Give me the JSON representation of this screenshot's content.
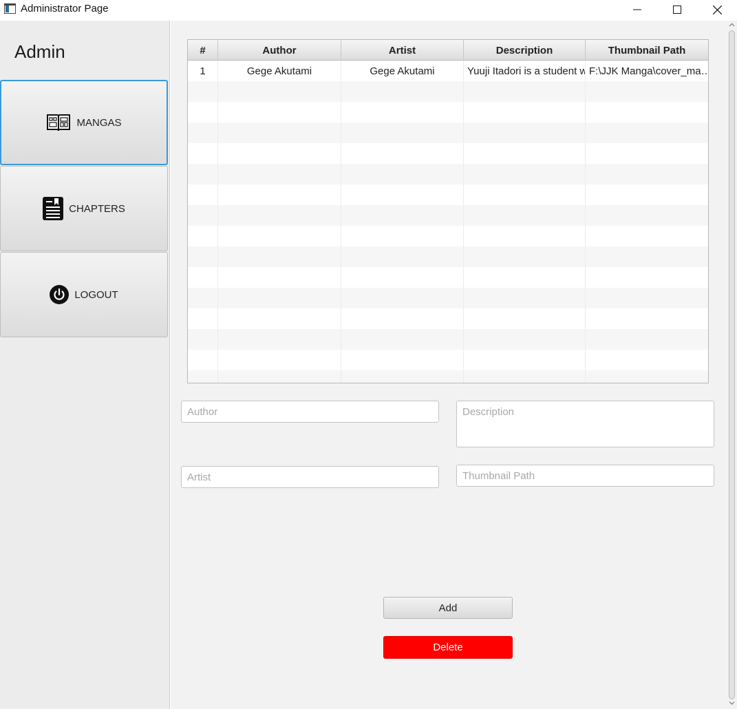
{
  "window": {
    "title": "Administrator Page",
    "icons": {
      "app": "app-window-icon",
      "minimize": "minimize-icon",
      "maximize": "maximize-icon",
      "close": "close-icon"
    }
  },
  "sidebar": {
    "title": "Admin",
    "items": [
      {
        "label": "MANGAS",
        "icon": "book-icon",
        "active": true
      },
      {
        "label": "CHAPTERS",
        "icon": "document-icon",
        "active": false
      },
      {
        "label": "LOGOUT",
        "icon": "power-icon",
        "active": false
      }
    ]
  },
  "table": {
    "columns": [
      "#",
      "Author",
      "Artist",
      "Description",
      "Thumbnail Path"
    ],
    "rows": [
      [
        "1",
        "Gege Akutami",
        "Gege Akutami",
        "Yuuji Itadori is a student w",
        "F:\\JJK Manga\\cover_ma…"
      ]
    ]
  },
  "form": {
    "author_placeholder": "Author",
    "artist_placeholder": "Artist",
    "description_placeholder": "Description",
    "thumbnail_placeholder": "Thumbnail Path"
  },
  "actions": {
    "add_label": "Add",
    "delete_label": "Delete",
    "delete_color": "#ff0000"
  },
  "colors": {
    "accent": "#3a9ad9"
  }
}
